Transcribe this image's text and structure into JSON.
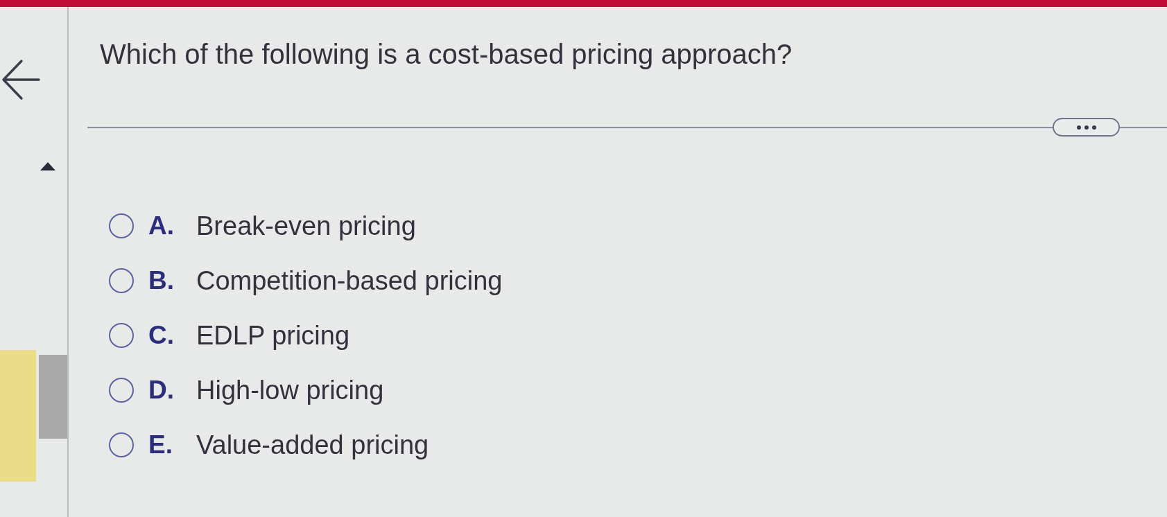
{
  "question": {
    "text": "Which of the following is a cost-based pricing approach?"
  },
  "options": [
    {
      "letter": "A.",
      "label": "Break-even pricing",
      "selected": false
    },
    {
      "letter": "B.",
      "label": "Competition-based pricing",
      "selected": false
    },
    {
      "letter": "C.",
      "label": "EDLP pricing",
      "selected": false
    },
    {
      "letter": "D.",
      "label": "High-low pricing",
      "selected": false
    },
    {
      "letter": "E.",
      "label": "Value-added pricing",
      "selected": false
    }
  ]
}
